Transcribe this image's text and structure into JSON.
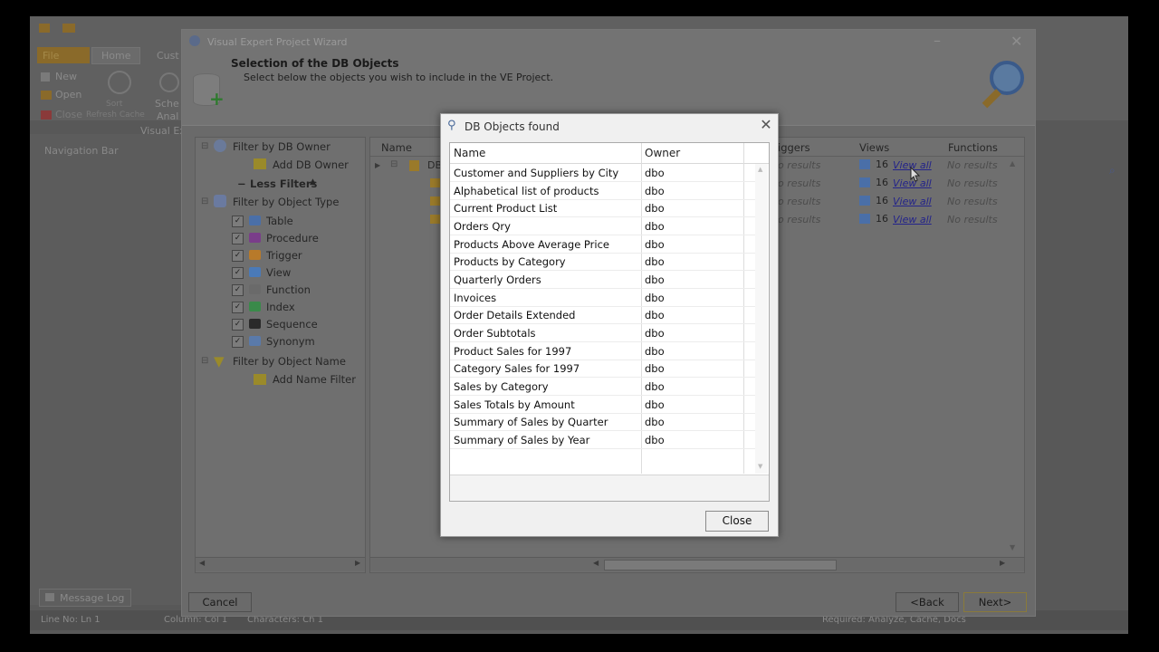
{
  "app": {
    "ribbon_tabs": [
      {
        "label": "File"
      },
      {
        "label": "Home"
      },
      {
        "label": "Cust"
      }
    ],
    "ribbon_buttons": [
      {
        "label": "New"
      },
      {
        "label": "Open"
      },
      {
        "label": "Close"
      }
    ],
    "ribbon_group_label": "Visual Ex",
    "schema_label": "Sche",
    "analyze_label": "Anal",
    "sort_label": "Sort",
    "refresh_label": "Refresh Cache",
    "navigation_bar": "Navigation Bar",
    "message_log": "Message Log",
    "status": {
      "line": "Line No: Ln 1",
      "column": "Column: Col 1",
      "characters": "Characters: Ch 1",
      "right": "Required: Analyze, Cache, Docs"
    }
  },
  "wizard": {
    "title": "Visual Expert Project Wizard",
    "heading": "Selection of the DB Objects",
    "subheading": "Select below the objects you wish to include in the VE Project.",
    "filters": {
      "by_owner": "Filter by DB Owner",
      "add_owner": "Add DB Owner",
      "less_filters": "Less Filters",
      "by_type": "Filter by Object Type",
      "types": [
        {
          "label": "Table",
          "checked": true,
          "icon": "table-icon",
          "color": "#4a6fa8"
        },
        {
          "label": "Procedure",
          "checked": true,
          "icon": "procedure-icon",
          "color": "#7a3d8a"
        },
        {
          "label": "Trigger",
          "checked": true,
          "icon": "trigger-icon",
          "color": "#b87a2a"
        },
        {
          "label": "View",
          "checked": true,
          "icon": "view-icon",
          "color": "#4a7ab8"
        },
        {
          "label": "Function",
          "checked": true,
          "icon": "function-icon",
          "color": "#6a6a6a"
        },
        {
          "label": "Index",
          "checked": true,
          "icon": "index-icon",
          "color": "#3a8a4a"
        },
        {
          "label": "Sequence",
          "checked": true,
          "icon": "sequence-icon",
          "color": "#2a2a2a"
        },
        {
          "label": "Synonym",
          "checked": true,
          "icon": "synonym-icon",
          "color": "#5a7aaa"
        }
      ],
      "by_name": "Filter by Object Name",
      "add_name": "Add Name Filter"
    },
    "grid": {
      "col_name": "Name",
      "col_triggers": "iggers",
      "col_views": "Views",
      "col_functions": "Functions",
      "db_node": "DB",
      "rows": [
        {
          "triggers": "o results",
          "views_count": "16",
          "views_link": "View all",
          "functions": "No results"
        },
        {
          "triggers": "o results",
          "views_count": "16",
          "views_link": "View all",
          "functions": "No results"
        },
        {
          "triggers": "o results",
          "views_count": "16",
          "views_link": "View all",
          "functions": "No results"
        },
        {
          "triggers": "o results",
          "views_count": "16",
          "views_link": "View all",
          "functions": "No results"
        }
      ]
    },
    "cancel": "Cancel",
    "back": "<Back",
    "next": "Next>"
  },
  "dialog": {
    "title": "DB Objects found",
    "col_name": "Name",
    "col_owner": "Owner",
    "rows": [
      {
        "name": "Customer and Suppliers by City",
        "owner": "dbo"
      },
      {
        "name": "Alphabetical list of products",
        "owner": "dbo"
      },
      {
        "name": "Current Product List",
        "owner": "dbo"
      },
      {
        "name": "Orders Qry",
        "owner": "dbo"
      },
      {
        "name": "Products Above Average Price",
        "owner": "dbo"
      },
      {
        "name": "Products by Category",
        "owner": "dbo"
      },
      {
        "name": "Quarterly Orders",
        "owner": "dbo"
      },
      {
        "name": "Invoices",
        "owner": "dbo"
      },
      {
        "name": "Order Details Extended",
        "owner": "dbo"
      },
      {
        "name": "Order Subtotals",
        "owner": "dbo"
      },
      {
        "name": "Product Sales for 1997",
        "owner": "dbo"
      },
      {
        "name": "Category Sales for 1997",
        "owner": "dbo"
      },
      {
        "name": "Sales by Category",
        "owner": "dbo"
      },
      {
        "name": "Sales Totals by Amount",
        "owner": "dbo"
      },
      {
        "name": "Summary of Sales by Quarter",
        "owner": "dbo"
      },
      {
        "name": "Summary of Sales by Year",
        "owner": "dbo"
      }
    ],
    "close_label": "Close"
  },
  "colors": {
    "dim_overlay": "#585858",
    "dialog_bg": "#f0f0f0",
    "link": "#23238a",
    "file_tab": "#8a6a2a"
  }
}
